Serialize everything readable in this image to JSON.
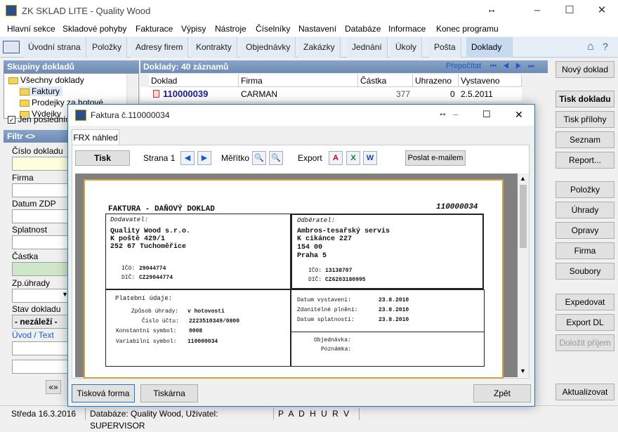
{
  "app": {
    "title": "ZK SKLAD LITE - Quality Wood"
  },
  "menu": [
    "Hlavní sekce",
    "Skladové pohyby",
    "Fakturace",
    "Výpisy",
    "Nástroje",
    "Číselníky",
    "Nastavení",
    "Databáze",
    "Informace",
    "Konec programu"
  ],
  "tabs": [
    "Úvodní strana",
    "Položky",
    "Adresy firem",
    "Kontrakty",
    "Objednávky",
    "Zakázky",
    "Jednání",
    "Úkoly",
    "Pošta",
    "Doklady"
  ],
  "left": {
    "groups_title": "Skupiny dokladů",
    "tree": [
      "Všechny doklady",
      "Faktury",
      "Prodejky za hotové",
      "Výdejky"
    ],
    "only_last": "Jen posledních",
    "filter_title": "Filtr <>",
    "fields": [
      "Číslo dokladu",
      "Firma",
      "Datum ZDP",
      "Splatnost",
      "Částka",
      "Zp.úhrady",
      "Stav dokladu"
    ],
    "stav_value": "- nezáleží -",
    "uvod_text": "Úvod / Text",
    "nav_btn": "«»"
  },
  "grid": {
    "title": "Doklady: 40 záznamů",
    "recalc": "Přepočítat",
    "columns": [
      "Doklad",
      "Firma",
      "Částka",
      "Uhrazeno",
      "Vystaveno"
    ],
    "rows": [
      {
        "doklad": "110000039",
        "firma": "CARMAN",
        "castka": "377",
        "uhrazeno": "0",
        "vystaveno": "2.5.2011"
      }
    ]
  },
  "right": [
    "Nový doklad",
    "Tisk dokladu",
    "Tisk přílohy",
    "Seznam",
    "Report...",
    "Položky",
    "Úhrady",
    "Opravy",
    "Firma",
    "Soubory",
    "Expedovat",
    "Export DL",
    "Doložit příjem",
    "Aktualizovat"
  ],
  "statusbar": {
    "date": "Středa 16.3.2016",
    "db": "Databáze: Quality Wood, Uživatel: SUPERVISOR",
    "flags": "P A D H U R V"
  },
  "dialog": {
    "title": "Faktura č.110000034",
    "tab": "FRX náhled",
    "print": "Tisk",
    "page": "Strana 1",
    "scale": "Měřítko",
    "export": "Export",
    "email": "Poslat e-mailem",
    "btn_form": "Tisková forma",
    "btn_printer": "Tiskárna",
    "btn_back": "Zpět"
  },
  "invoice": {
    "heading": "FAKTURA - DAŇOVÝ DOKLAD",
    "number": "110000034",
    "supplier_label": "Dodavatel:",
    "supplier": [
      "Quality Wood s.r.o.",
      "K poště 429/1",
      "252 67 Tuchoměřice"
    ],
    "supplier_ico_l": "IČO:",
    "supplier_ico": "29044774",
    "supplier_dic_l": "DIČ:",
    "supplier_dic": "CZ29044774",
    "customer_label": "Odběratel:",
    "customer": [
      "Ambros-tesařský servis",
      "K cikánce 227",
      "154 00",
      "Praha 5"
    ],
    "customer_ico_l": "IČO:",
    "customer_ico": "13138707",
    "customer_dic_l": "DIČ:",
    "customer_dic": "CZ6203180995",
    "payment_label": "Platební údaje:",
    "pay_method_l": "Způsob úhrady:",
    "pay_method": "v hotovosti",
    "account_l": "Číslo účtu:",
    "account": "2223510349/0800",
    "const_l": "Konstantní symbol:",
    "const": "0008",
    "var_l": "Variabilní symbol:",
    "var": "110000034",
    "issued_l": "Datum vystavení:",
    "issued": "23.8.2010",
    "taxable_l": "Zdanitelné plnění:",
    "taxable": "23.8.2010",
    "due_l": "Datum splatnosti:",
    "due": "23.8.2010",
    "order_l": "Objednávka:",
    "note_l": "Poznámka:"
  },
  "colors": {
    "accent": "#1979ca",
    "header": "#6f8bb4",
    "link": "#1a5bc8",
    "doc_number": "#1a1a8c"
  }
}
